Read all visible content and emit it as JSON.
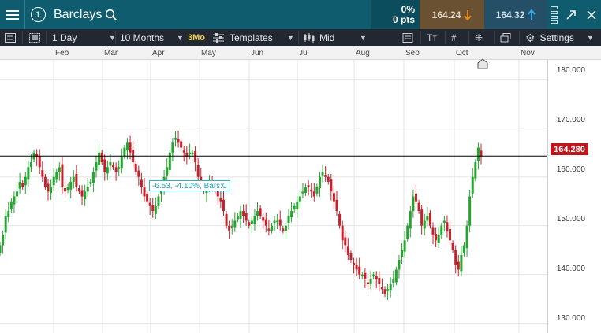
{
  "header": {
    "menu_icon": "hamburger-icon",
    "instrument_number": "1",
    "title": "Barclays",
    "change_percent": "0%",
    "change_points": "0 pts",
    "sell_price": "164.24",
    "buy_price": "164.32",
    "sell_arrow_color": "#e58a1f",
    "buy_arrow_color": "#3aa9e8"
  },
  "toolbar": {
    "interval": "1 Day",
    "range": "10 Months",
    "range_badge": "3Mo",
    "templates_label": "Templates",
    "price_type": "Mid",
    "settings_label": "Settings"
  },
  "months": [
    "Feb",
    "Mar",
    "Apr",
    "May",
    "Jun",
    "Jul",
    "Aug",
    "Sep",
    "Oct",
    "Nov"
  ],
  "price_axis": [
    "180.000",
    "170.000",
    "160.000",
    "150.000",
    "140.000",
    "130.000"
  ],
  "current_price_label": "164.280",
  "measure_label": "-6.53, -4.10%, Bars:0",
  "colors": {
    "up": "#22a62d",
    "down": "#c8202a",
    "header": "#0f5c6e",
    "toolbar": "#222831",
    "price_line": "#000000",
    "current_price_badge": "#c0161d"
  },
  "chart_data": {
    "type": "candlestick",
    "ylim": [
      128,
      184
    ],
    "grid": true,
    "current_price": 164.28,
    "close": [
      146,
      148,
      152,
      153,
      155,
      156,
      157,
      159,
      158,
      160,
      162,
      163,
      165,
      164,
      162,
      160,
      158,
      157,
      158,
      160,
      161,
      162,
      158,
      157,
      158,
      159,
      160,
      158,
      157,
      156,
      157,
      158,
      159,
      161,
      163,
      165,
      163,
      161,
      162,
      163,
      162,
      161,
      162,
      164,
      166,
      167,
      165,
      163,
      161,
      160,
      158,
      156,
      155,
      154,
      153,
      154,
      156,
      158,
      160,
      162,
      165,
      167,
      168,
      167,
      166,
      165,
      164,
      165,
      165,
      163,
      160,
      158,
      157,
      158,
      159,
      158,
      157,
      156,
      155,
      153,
      150,
      149,
      150,
      151,
      152,
      153,
      152,
      151,
      150,
      151,
      152,
      153,
      152,
      151,
      150,
      149,
      150,
      151,
      151,
      150,
      149,
      150,
      152,
      153,
      154,
      155,
      156,
      157,
      158,
      158,
      157,
      156,
      158,
      160,
      161,
      160,
      159,
      157,
      155,
      153,
      150,
      147,
      146,
      144,
      143,
      142,
      141,
      140,
      140,
      139,
      138,
      139,
      140,
      139,
      138,
      137,
      136,
      137,
      138,
      139,
      141,
      143,
      145,
      147,
      150,
      153,
      156,
      155,
      153,
      150,
      151,
      152,
      150,
      148,
      147,
      148,
      150,
      151,
      149,
      147,
      145,
      142,
      141,
      144,
      146,
      150,
      156,
      160,
      163,
      166,
      164
    ]
  }
}
